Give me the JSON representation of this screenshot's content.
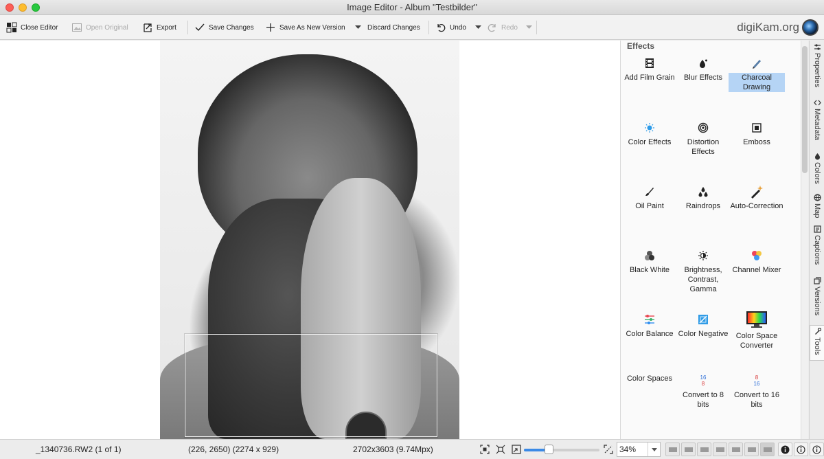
{
  "window": {
    "title": "Image Editor - Album \"Testbilder\""
  },
  "toolbar": {
    "close_editor": "Close Editor",
    "open_original": "Open Original",
    "export": "Export",
    "save_changes": "Save Changes",
    "save_new_version": "Save As New Version",
    "discard_changes": "Discard Changes",
    "undo": "Undo",
    "redo": "Redo",
    "logo": "digiKam.org"
  },
  "panel": {
    "title": "Effects",
    "tools": [
      {
        "label": "Add Film Grain",
        "icon": "film-icon"
      },
      {
        "label": "Blur Effects",
        "icon": "drops-icon"
      },
      {
        "label": "Charcoal Drawing",
        "icon": "pencil-icon",
        "selected": true
      },
      {
        "label": "Color Effects",
        "icon": "sun-icon"
      },
      {
        "label": "Distortion Effects",
        "icon": "spiral-icon"
      },
      {
        "label": "Emboss",
        "icon": "emboss-icon"
      },
      {
        "label": "Oil Paint",
        "icon": "brush-icon"
      },
      {
        "label": "Raindrops",
        "icon": "raindrops-icon"
      },
      {
        "label": "Auto-Correction",
        "icon": "magic-wand-icon"
      },
      {
        "label": "Black  White",
        "icon": "bw-circles-icon"
      },
      {
        "label": "Brightness, Contrast, Gamma",
        "icon": "brightness-icon"
      },
      {
        "label": "Channel Mixer",
        "icon": "rgb-circles-icon"
      },
      {
        "label": "Color Balance",
        "icon": "sliders-icon"
      },
      {
        "label": "Color Negative",
        "icon": "negative-icon"
      },
      {
        "label": "Color Space Converter",
        "icon": "monitor-icon"
      },
      {
        "label": "Color Spaces",
        "icon": ""
      },
      {
        "label": "Convert to 8 bits",
        "icon": "convert-8-icon",
        "badge_top": "16",
        "badge_bottom": "8"
      },
      {
        "label": "Convert to 16 bits",
        "icon": "convert-16-icon",
        "badge_top": "8",
        "badge_bottom": "16"
      }
    ]
  },
  "sidetabs": [
    {
      "label": "Properties",
      "icon": "properties-icon"
    },
    {
      "label": "Metadata",
      "icon": "metadata-icon"
    },
    {
      "label": "Colors",
      "icon": "colors-icon"
    },
    {
      "label": "Map",
      "icon": "globe-icon"
    },
    {
      "label": "Captions",
      "icon": "captions-icon"
    },
    {
      "label": "Versions",
      "icon": "versions-icon"
    },
    {
      "label": "Tools",
      "icon": "tools-icon",
      "active": true
    }
  ],
  "status": {
    "filename": "_1340736.RW2 (1 of 1)",
    "coords": "(226, 2650) (2274 x 929)",
    "dimensions": "2702x3603 (9.74Mpx)",
    "zoom_value": "34%",
    "zoom_level": 0.34
  },
  "colors": {
    "accent": "#3b8ae6",
    "selection": "#b5d4f5"
  }
}
